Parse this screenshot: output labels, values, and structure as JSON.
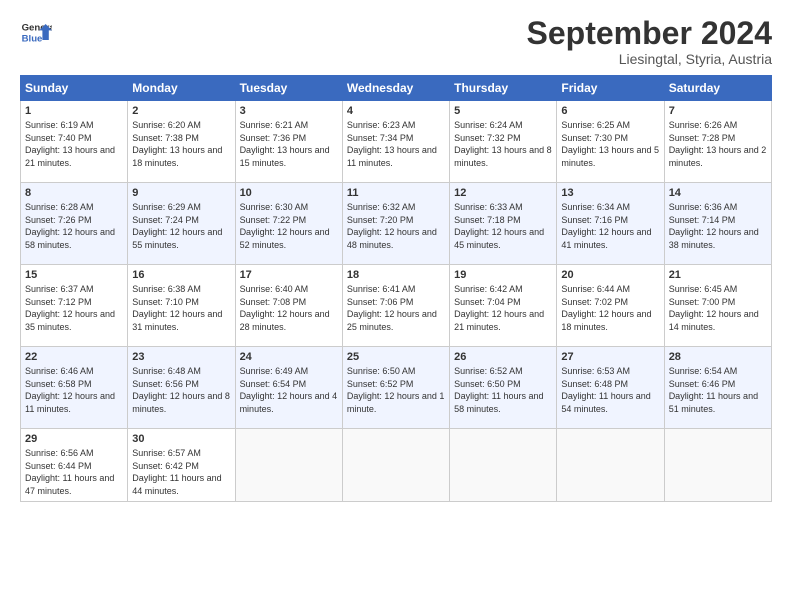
{
  "header": {
    "logo_line1": "General",
    "logo_line2": "Blue",
    "month": "September 2024",
    "location": "Liesingtal, Styria, Austria"
  },
  "days_of_week": [
    "Sunday",
    "Monday",
    "Tuesday",
    "Wednesday",
    "Thursday",
    "Friday",
    "Saturday"
  ],
  "weeks": [
    [
      {
        "day": "1",
        "sunrise": "6:19 AM",
        "sunset": "7:40 PM",
        "daylight": "13 hours and 21 minutes."
      },
      {
        "day": "2",
        "sunrise": "6:20 AM",
        "sunset": "7:38 PM",
        "daylight": "13 hours and 18 minutes."
      },
      {
        "day": "3",
        "sunrise": "6:21 AM",
        "sunset": "7:36 PM",
        "daylight": "13 hours and 15 minutes."
      },
      {
        "day": "4",
        "sunrise": "6:23 AM",
        "sunset": "7:34 PM",
        "daylight": "13 hours and 11 minutes."
      },
      {
        "day": "5",
        "sunrise": "6:24 AM",
        "sunset": "7:32 PM",
        "daylight": "13 hours and 8 minutes."
      },
      {
        "day": "6",
        "sunrise": "6:25 AM",
        "sunset": "7:30 PM",
        "daylight": "13 hours and 5 minutes."
      },
      {
        "day": "7",
        "sunrise": "6:26 AM",
        "sunset": "7:28 PM",
        "daylight": "13 hours and 2 minutes."
      }
    ],
    [
      {
        "day": "8",
        "sunrise": "6:28 AM",
        "sunset": "7:26 PM",
        "daylight": "12 hours and 58 minutes."
      },
      {
        "day": "9",
        "sunrise": "6:29 AM",
        "sunset": "7:24 PM",
        "daylight": "12 hours and 55 minutes."
      },
      {
        "day": "10",
        "sunrise": "6:30 AM",
        "sunset": "7:22 PM",
        "daylight": "12 hours and 52 minutes."
      },
      {
        "day": "11",
        "sunrise": "6:32 AM",
        "sunset": "7:20 PM",
        "daylight": "12 hours and 48 minutes."
      },
      {
        "day": "12",
        "sunrise": "6:33 AM",
        "sunset": "7:18 PM",
        "daylight": "12 hours and 45 minutes."
      },
      {
        "day": "13",
        "sunrise": "6:34 AM",
        "sunset": "7:16 PM",
        "daylight": "12 hours and 41 minutes."
      },
      {
        "day": "14",
        "sunrise": "6:36 AM",
        "sunset": "7:14 PM",
        "daylight": "12 hours and 38 minutes."
      }
    ],
    [
      {
        "day": "15",
        "sunrise": "6:37 AM",
        "sunset": "7:12 PM",
        "daylight": "12 hours and 35 minutes."
      },
      {
        "day": "16",
        "sunrise": "6:38 AM",
        "sunset": "7:10 PM",
        "daylight": "12 hours and 31 minutes."
      },
      {
        "day": "17",
        "sunrise": "6:40 AM",
        "sunset": "7:08 PM",
        "daylight": "12 hours and 28 minutes."
      },
      {
        "day": "18",
        "sunrise": "6:41 AM",
        "sunset": "7:06 PM",
        "daylight": "12 hours and 25 minutes."
      },
      {
        "day": "19",
        "sunrise": "6:42 AM",
        "sunset": "7:04 PM",
        "daylight": "12 hours and 21 minutes."
      },
      {
        "day": "20",
        "sunrise": "6:44 AM",
        "sunset": "7:02 PM",
        "daylight": "12 hours and 18 minutes."
      },
      {
        "day": "21",
        "sunrise": "6:45 AM",
        "sunset": "7:00 PM",
        "daylight": "12 hours and 14 minutes."
      }
    ],
    [
      {
        "day": "22",
        "sunrise": "6:46 AM",
        "sunset": "6:58 PM",
        "daylight": "12 hours and 11 minutes."
      },
      {
        "day": "23",
        "sunrise": "6:48 AM",
        "sunset": "6:56 PM",
        "daylight": "12 hours and 8 minutes."
      },
      {
        "day": "24",
        "sunrise": "6:49 AM",
        "sunset": "6:54 PM",
        "daylight": "12 hours and 4 minutes."
      },
      {
        "day": "25",
        "sunrise": "6:50 AM",
        "sunset": "6:52 PM",
        "daylight": "12 hours and 1 minute."
      },
      {
        "day": "26",
        "sunrise": "6:52 AM",
        "sunset": "6:50 PM",
        "daylight": "11 hours and 58 minutes."
      },
      {
        "day": "27",
        "sunrise": "6:53 AM",
        "sunset": "6:48 PM",
        "daylight": "11 hours and 54 minutes."
      },
      {
        "day": "28",
        "sunrise": "6:54 AM",
        "sunset": "6:46 PM",
        "daylight": "11 hours and 51 minutes."
      }
    ],
    [
      {
        "day": "29",
        "sunrise": "6:56 AM",
        "sunset": "6:44 PM",
        "daylight": "11 hours and 47 minutes."
      },
      {
        "day": "30",
        "sunrise": "6:57 AM",
        "sunset": "6:42 PM",
        "daylight": "11 hours and 44 minutes."
      },
      null,
      null,
      null,
      null,
      null
    ]
  ]
}
